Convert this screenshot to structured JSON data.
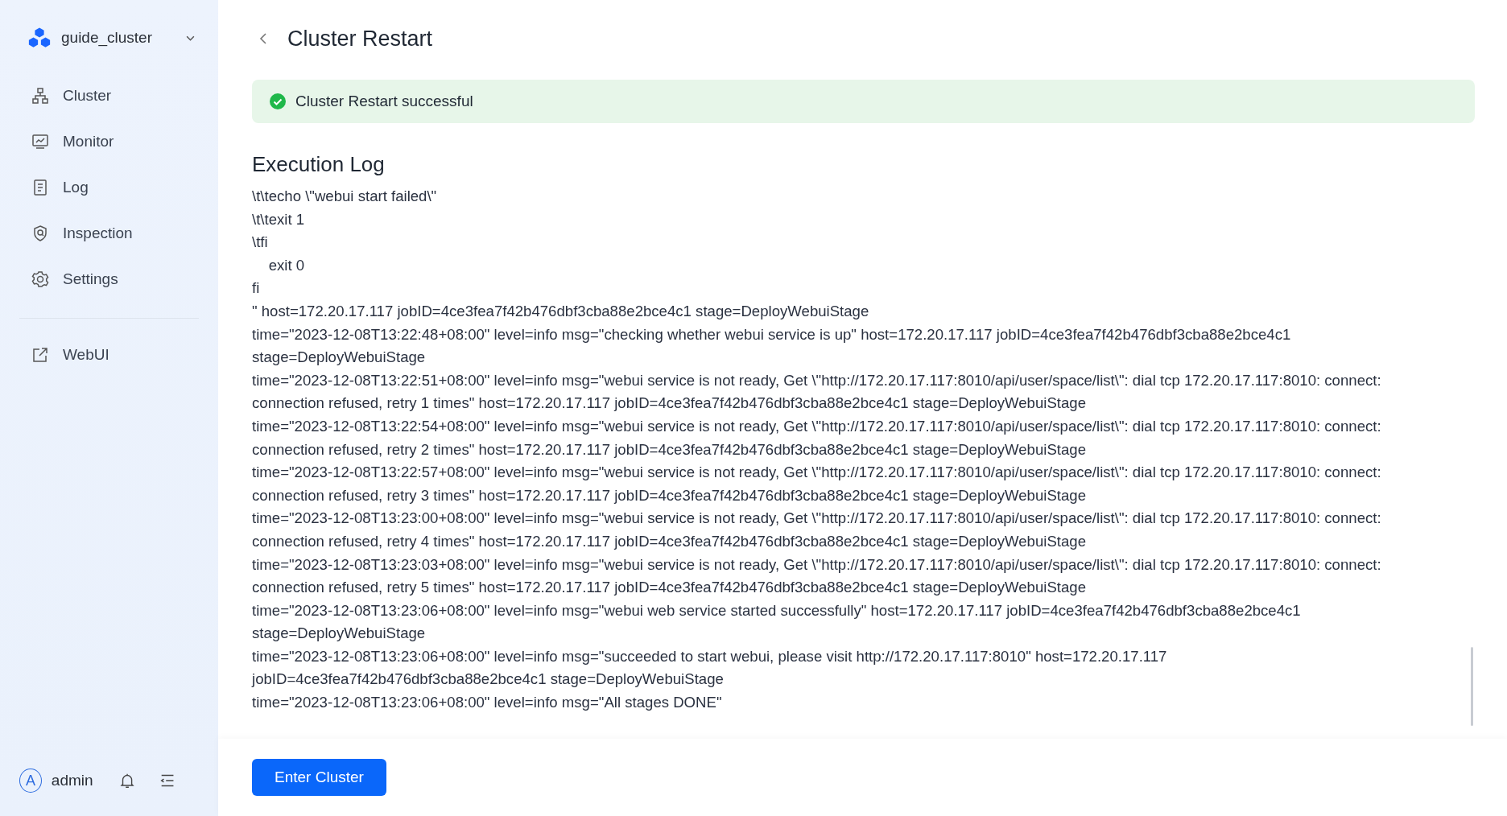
{
  "sidebar": {
    "cluster_name": "guide_cluster",
    "items": [
      {
        "label": "Cluster"
      },
      {
        "label": "Monitor"
      },
      {
        "label": "Log"
      },
      {
        "label": "Inspection"
      },
      {
        "label": "Settings"
      }
    ],
    "links": [
      {
        "label": "WebUI"
      }
    ],
    "user": {
      "avatar": "A",
      "name": "admin"
    }
  },
  "header": {
    "title": "Cluster Restart"
  },
  "alert": {
    "kind": "success",
    "message": "Cluster Restart successful"
  },
  "log": {
    "title": "Execution Log",
    "lines": [
      "\\t\\techo \\\"webui start failed\\\"",
      "\\t\\texit 1",
      "\\tfi",
      "    exit 0",
      "fi",
      "\" host=172.20.17.117 jobID=4ce3fea7f42b476dbf3cba88e2bce4c1 stage=DeployWebuiStage",
      "time=\"2023-12-08T13:22:48+08:00\" level=info msg=\"checking whether webui service is up\" host=172.20.17.117 jobID=4ce3fea7f42b476dbf3cba88e2bce4c1 stage=DeployWebuiStage",
      "time=\"2023-12-08T13:22:51+08:00\" level=info msg=\"webui service is not ready, Get \\\"http://172.20.17.117:8010/api/user/space/list\\\": dial tcp 172.20.17.117:8010: connect: connection refused, retry 1 times\" host=172.20.17.117 jobID=4ce3fea7f42b476dbf3cba88e2bce4c1 stage=DeployWebuiStage",
      "time=\"2023-12-08T13:22:54+08:00\" level=info msg=\"webui service is not ready, Get \\\"http://172.20.17.117:8010/api/user/space/list\\\": dial tcp 172.20.17.117:8010: connect: connection refused, retry 2 times\" host=172.20.17.117 jobID=4ce3fea7f42b476dbf3cba88e2bce4c1 stage=DeployWebuiStage",
      "time=\"2023-12-08T13:22:57+08:00\" level=info msg=\"webui service is not ready, Get \\\"http://172.20.17.117:8010/api/user/space/list\\\": dial tcp 172.20.17.117:8010: connect: connection refused, retry 3 times\" host=172.20.17.117 jobID=4ce3fea7f42b476dbf3cba88e2bce4c1 stage=DeployWebuiStage",
      "time=\"2023-12-08T13:23:00+08:00\" level=info msg=\"webui service is not ready, Get \\\"http://172.20.17.117:8010/api/user/space/list\\\": dial tcp 172.20.17.117:8010: connect: connection refused, retry 4 times\" host=172.20.17.117 jobID=4ce3fea7f42b476dbf3cba88e2bce4c1 stage=DeployWebuiStage",
      "time=\"2023-12-08T13:23:03+08:00\" level=info msg=\"webui service is not ready, Get \\\"http://172.20.17.117:8010/api/user/space/list\\\": dial tcp 172.20.17.117:8010: connect: connection refused, retry 5 times\" host=172.20.17.117 jobID=4ce3fea7f42b476dbf3cba88e2bce4c1 stage=DeployWebuiStage",
      "time=\"2023-12-08T13:23:06+08:00\" level=info msg=\"webui web service started successfully\" host=172.20.17.117 jobID=4ce3fea7f42b476dbf3cba88e2bce4c1 stage=DeployWebuiStage",
      "time=\"2023-12-08T13:23:06+08:00\" level=info msg=\"succeeded to start webui, please visit http://172.20.17.117:8010\" host=172.20.17.117 jobID=4ce3fea7f42b476dbf3cba88e2bce4c1 stage=DeployWebuiStage",
      "time=\"2023-12-08T13:23:06+08:00\" level=info msg=\"All stages DONE\""
    ]
  },
  "footer": {
    "button": "Enter Cluster"
  }
}
